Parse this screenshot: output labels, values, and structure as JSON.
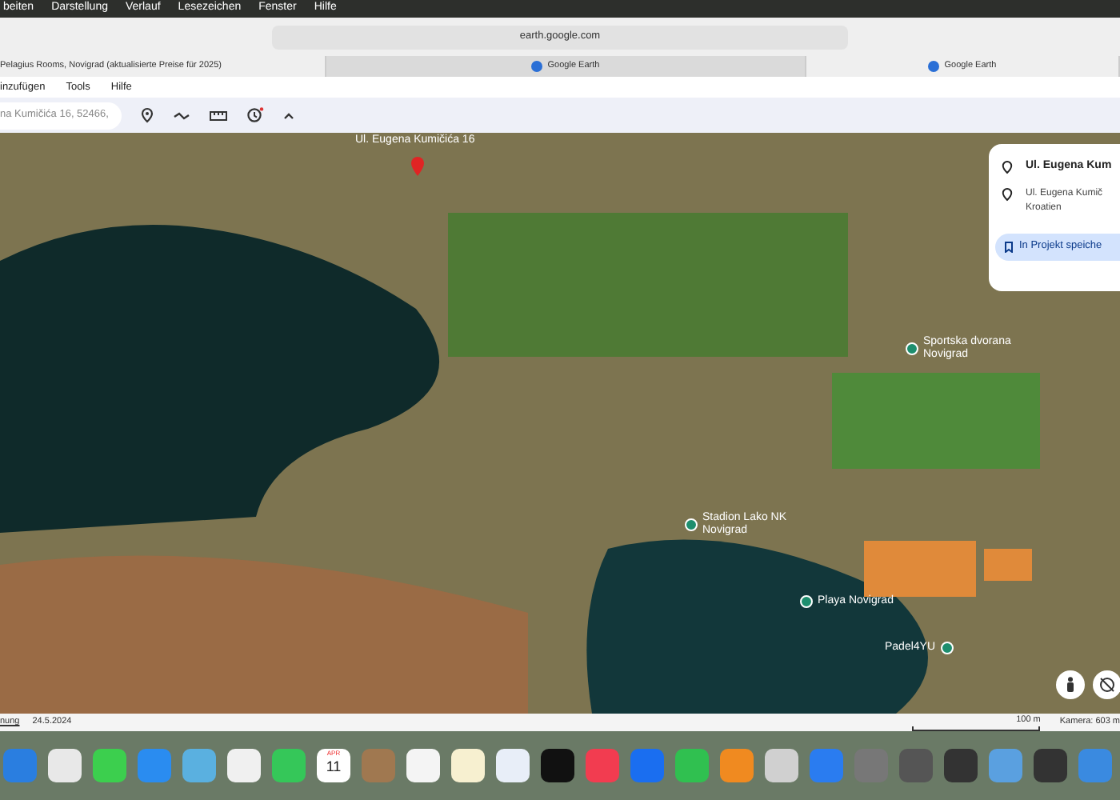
{
  "menu_bar": {
    "items": [
      "beiten",
      "Darstellung",
      "Verlauf",
      "Lesezeichen",
      "Fenster",
      "Hilfe"
    ]
  },
  "address_bar": {
    "url": "earth.google.com"
  },
  "tabs": [
    {
      "label": "Pelagius Rooms, Novigrad (aktualisierte Preise für 2025)",
      "selected": false,
      "has_icon": false
    },
    {
      "label": "Google Earth",
      "selected": true,
      "has_icon": true
    },
    {
      "label": "Google Earth",
      "selected": false,
      "has_icon": true
    }
  ],
  "app_menu": [
    "inzufügen",
    "Tools",
    "Hilfe"
  ],
  "search": {
    "value": "na Kumičića 16, 52466,"
  },
  "map_labels": [
    {
      "text": "Ul. Eugena Kumičića 16",
      "kind": "address"
    },
    {
      "text": "Sportska dvorana Novigrad",
      "kind": "poi"
    },
    {
      "text": "Stadion Lako NK Novigrad",
      "kind": "poi"
    },
    {
      "text": "Playa Novigrad",
      "kind": "poi"
    },
    {
      "text": "Padel4YU",
      "kind": "poi"
    }
  ],
  "info_card": {
    "title": "Ul. Eugena Kum",
    "address": "Ul. Eugena Kumič",
    "country": "Kroatien",
    "save_button": "In Projekt speiche"
  },
  "status_bar": {
    "left": "nung",
    "date": "24.5.2024",
    "scale": "100 m",
    "camera": "Kamera: 603 m"
  },
  "dock": {
    "calendar_month": "APR",
    "calendar_day": "11"
  }
}
